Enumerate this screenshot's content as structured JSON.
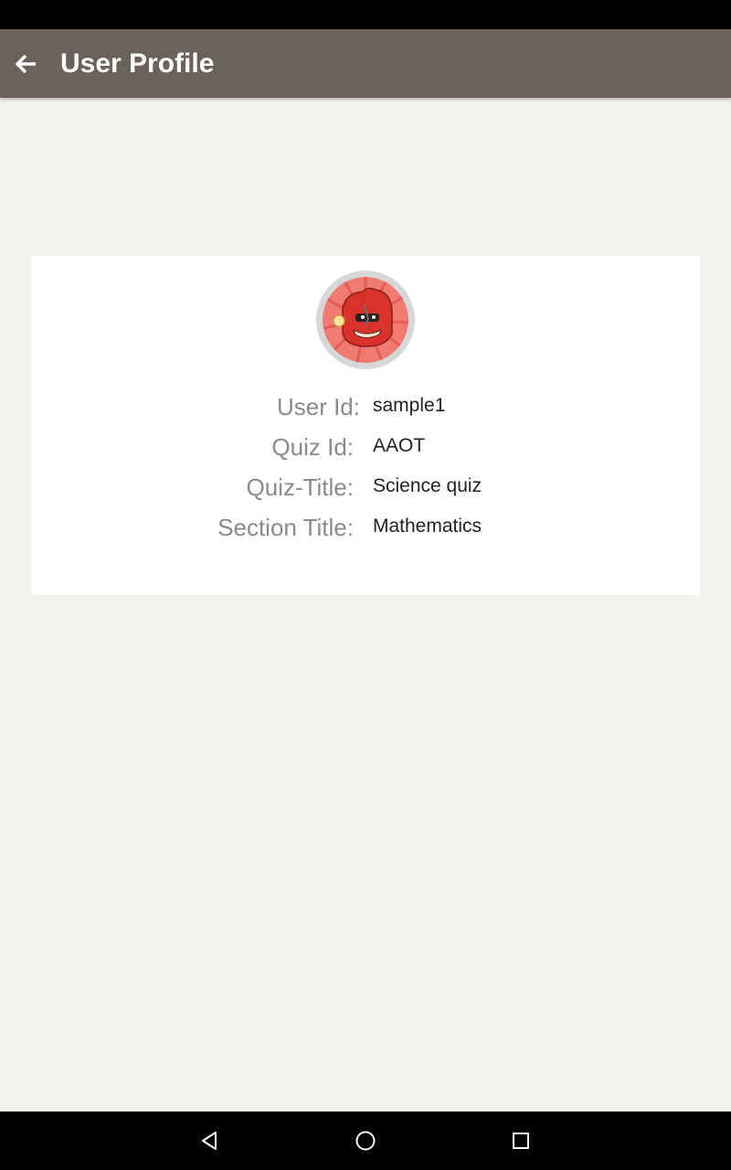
{
  "app_bar": {
    "title": "User Profile",
    "back_icon": "arrow-left-icon",
    "background": "#68625b"
  },
  "profile": {
    "avatar_icon": "red-monster-avatar",
    "fields": [
      {
        "label": "User Id:",
        "value": "sample1"
      },
      {
        "label": "Quiz Id:",
        "value": "AAOT"
      },
      {
        "label": "Quiz-Title:",
        "value": "Science quiz"
      },
      {
        "label": "Section Title:",
        "value": "Mathematics"
      }
    ]
  },
  "nav_bar": {
    "back_icon": "triangle-back-icon",
    "home_icon": "circle-home-icon",
    "recents_icon": "square-recents-icon"
  }
}
